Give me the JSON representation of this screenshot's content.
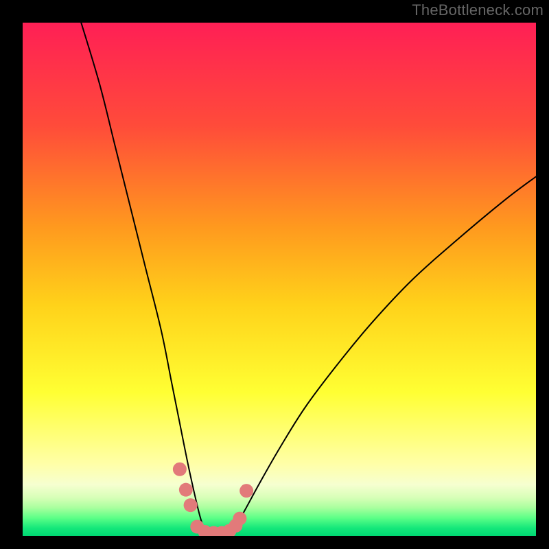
{
  "watermark": "TheBottleneck.com",
  "chart_data": {
    "type": "line",
    "title": "",
    "xlabel": "",
    "ylabel": "",
    "xlim": [
      0,
      100
    ],
    "ylim": [
      0,
      100
    ],
    "gradient_stops": [
      {
        "offset": 0.0,
        "color": "#ff1f55"
      },
      {
        "offset": 0.2,
        "color": "#ff4b3a"
      },
      {
        "offset": 0.4,
        "color": "#ff9a1e"
      },
      {
        "offset": 0.55,
        "color": "#ffd21a"
      },
      {
        "offset": 0.72,
        "color": "#ffff33"
      },
      {
        "offset": 0.86,
        "color": "#ffffa8"
      },
      {
        "offset": 0.9,
        "color": "#f6ffd0"
      },
      {
        "offset": 0.925,
        "color": "#d8ffb8"
      },
      {
        "offset": 0.945,
        "color": "#a9ff9e"
      },
      {
        "offset": 0.965,
        "color": "#5cff87"
      },
      {
        "offset": 0.985,
        "color": "#14e77a"
      },
      {
        "offset": 1.0,
        "color": "#00d873"
      }
    ],
    "series": [
      {
        "name": "left-curve",
        "x": [
          11.4,
          15.0,
          18.0,
          21.0,
          24.0,
          27.0,
          29.0,
          30.6,
          32.0,
          33.3,
          34.5,
          35.4,
          36.0
        ],
        "y": [
          100.0,
          88.0,
          76.0,
          64.0,
          52.0,
          40.0,
          30.0,
          22.0,
          15.0,
          9.0,
          4.0,
          1.2,
          0.0
        ]
      },
      {
        "name": "right-curve",
        "x": [
          40.0,
          41.2,
          43.0,
          46.0,
          50.0,
          55.0,
          61.0,
          68.0,
          76.0,
          85.0,
          94.0,
          100.0
        ],
        "y": [
          0.0,
          1.5,
          4.5,
          10.0,
          17.0,
          25.0,
          33.0,
          41.5,
          50.0,
          58.0,
          65.5,
          70.0
        ]
      },
      {
        "name": "valley-floor",
        "x": [
          36.0,
          37.0,
          38.0,
          39.0,
          40.0
        ],
        "y": [
          0.0,
          0.0,
          0.0,
          0.0,
          0.0
        ]
      }
    ],
    "dots": {
      "name": "dot-markers",
      "color": "#e27a7a",
      "radius_px": 10,
      "points": [
        {
          "x": 30.6,
          "y": 13.0
        },
        {
          "x": 31.8,
          "y": 9.0
        },
        {
          "x": 32.7,
          "y": 6.0
        },
        {
          "x": 34.0,
          "y": 1.8
        },
        {
          "x": 35.5,
          "y": 0.8
        },
        {
          "x": 37.2,
          "y": 0.6
        },
        {
          "x": 38.8,
          "y": 0.6
        },
        {
          "x": 40.3,
          "y": 1.0
        },
        {
          "x": 41.5,
          "y": 2.0
        },
        {
          "x": 42.3,
          "y": 3.4
        },
        {
          "x": 43.6,
          "y": 8.8
        }
      ]
    }
  }
}
